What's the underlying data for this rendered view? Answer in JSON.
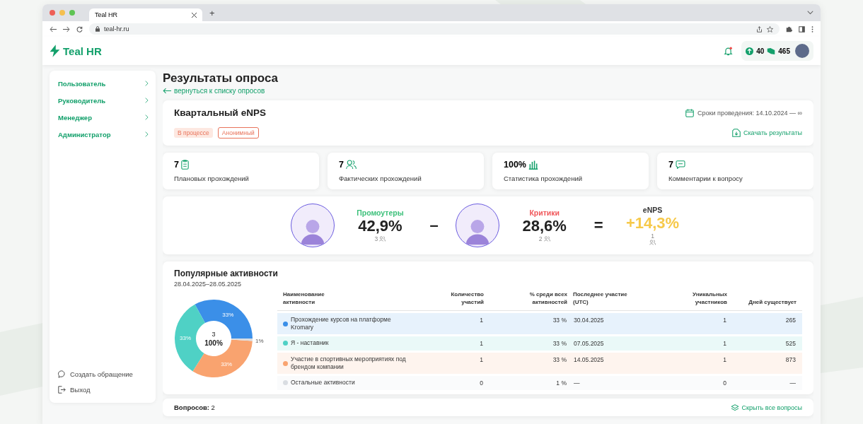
{
  "browser": {
    "tab_title": "Teal HR",
    "new_tab": "+",
    "url": "teal-hr.ru"
  },
  "header": {
    "logo": "Teal HR",
    "coins": "40",
    "points": "465"
  },
  "sidebar": {
    "items": [
      {
        "label": "Пользователь"
      },
      {
        "label": "Руководитель"
      },
      {
        "label": "Менеджер"
      },
      {
        "label": "Администратор"
      }
    ],
    "footer": [
      {
        "label": "Создать обращение",
        "kind": "support"
      },
      {
        "label": "Выход",
        "kind": "logout"
      }
    ]
  },
  "page": {
    "title": "Результаты опроса",
    "back_link": "вернуться к списку опросов"
  },
  "survey": {
    "title": "Квартальный eNPS",
    "dates": "Сроки проведения: 14.10.2024 — ∞",
    "tags": [
      {
        "label": "В процессе",
        "kind": "filled"
      },
      {
        "label": "Анонимный",
        "kind": "outline"
      }
    ],
    "download": "Скачать результаты"
  },
  "stats": [
    {
      "value": "7",
      "label": "Плановых прохождений",
      "kind": "clipboard"
    },
    {
      "value": "7",
      "label": "Фактических прохождений",
      "kind": "people"
    },
    {
      "value": "100%",
      "label": "Статистика прохождений",
      "kind": "bars"
    },
    {
      "value": "7",
      "label": "Комментарии к вопросу",
      "kind": "comment"
    }
  ],
  "enps": {
    "groups": [
      {
        "title": "Промоутеры",
        "value": "42,9%",
        "count": "3",
        "kind": "promoters"
      },
      {
        "title": "Критики",
        "value": "28,6%",
        "count": "2",
        "kind": "critics"
      }
    ],
    "minus": "–",
    "equals": "=",
    "result": {
      "title": "eNPS",
      "value": "+14,3%",
      "count": "1"
    }
  },
  "activities": {
    "title": "Популярные активности",
    "period": "28.04.2025–28.05.2025",
    "center_count": "3",
    "center_total": "100%",
    "chart_data": {
      "type": "donut",
      "categories": [
        "Прохождение курсов на платформе Kromary",
        "Я - наставник",
        "Участие в спортивных мероприятиях под брендом компании",
        "Остальные активности"
      ],
      "values": [
        33,
        33,
        33,
        1
      ],
      "value_labels": [
        "33%",
        "33%",
        "33%",
        "1%"
      ]
    },
    "columns": [
      "Наименование активности",
      "Количество участий",
      "% среди всех активностей",
      "Последнее участие (UTC)",
      "Уникальных участников",
      "Дней существует"
    ],
    "rows": [
      {
        "color": "#3b8fe8",
        "count": "1",
        "share": "33 %",
        "last": "30.04.2025",
        "unique": "1",
        "days": "265"
      },
      {
        "color": "#4fd1c5",
        "count": "1",
        "share": "33 %",
        "last": "07.05.2025",
        "unique": "1",
        "days": "525"
      },
      {
        "color": "#f9a36f",
        "count": "1",
        "share": "33 %",
        "last": "14.05.2025",
        "unique": "1",
        "days": "873"
      },
      {
        "color": "#d9dde2",
        "count": "0",
        "share": "1 %",
        "last": "—",
        "unique": "0",
        "days": "—"
      }
    ]
  },
  "questions": {
    "label": "Вопросов:",
    "count": "2",
    "toggle": "Скрыть все вопросы"
  }
}
